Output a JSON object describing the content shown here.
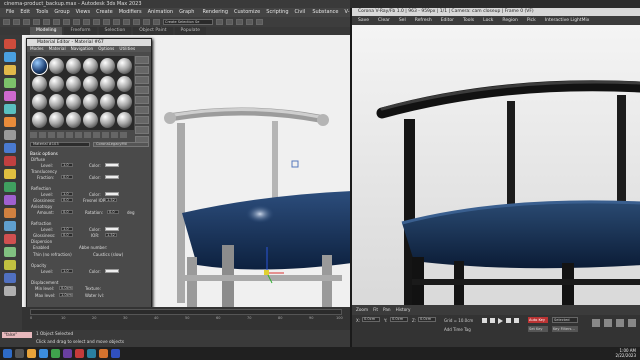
{
  "app": {
    "window_title": "cinema-product_backup.max - Autodesk 3ds Max 2023",
    "menu": [
      "File",
      "Edit",
      "Tools",
      "Group",
      "Views",
      "Create",
      "Modifiers",
      "Animation",
      "Graph Editors",
      "Rendering",
      "Customize",
      "Scripting",
      "Civil View",
      "Substance",
      "V-Ray",
      "Arnold",
      "Help"
    ],
    "toolbar_dropdown": "Create Selection Se",
    "ribbon_tabs": [
      "Modeling",
      "Freeform",
      "Selection",
      "Object Paint",
      "Populate"
    ],
    "ribbon_sub": "Polygon Modeling"
  },
  "material_editor": {
    "title": "Material Editor - Material #67",
    "menu": [
      "Modes",
      "Material",
      "Navigation",
      "Options",
      "Utilities"
    ],
    "material_name": "Material #103",
    "material_type": "CoronaLegacyMtl",
    "sections": {
      "basic": "Basic options",
      "diffuse": "Diffuse",
      "level": "Level:",
      "level_val": "1.0",
      "color": "Color:",
      "translucency": "Translucency",
      "fraction": "Fraction:",
      "fraction_val": "0.0",
      "reflection": "Reflection",
      "glossiness": "Glossiness:",
      "gloss_val": "0.0",
      "fresnel": "Fresnel IOR:",
      "fresnel_val": "1.52",
      "anisotropy": "Anisotropy",
      "amount": "Amount:",
      "amount_val": "0.0",
      "rotation": "Rotation:",
      "rot_val": "0.0",
      "deg": "deg",
      "refraction": "Refraction",
      "ior": "IOR:",
      "ior_val": "1.52",
      "dispersion": "Dispersion",
      "enabled": "Enabled",
      "abbe": "Abbe number:",
      "thin": "Thin (no refraction)",
      "caustics": "Caustics (slow)",
      "opacity": "Opacity",
      "displacement": "Displacement",
      "min_level": "Min level:",
      "min_val": "0.0cm",
      "texture": "Texture:",
      "max_level": "Max level:",
      "max_val": "1.0cm",
      "water_level": "Water lvl:"
    }
  },
  "status": {
    "maxscript": "\"false\"",
    "line1": "1 Object Selected",
    "line2": "Click and drag to select and move objects"
  },
  "timeline": {
    "ticks": [
      "0",
      "10",
      "20",
      "30",
      "40",
      "50",
      "60",
      "70",
      "80",
      "90",
      "100"
    ]
  },
  "render_window": {
    "title": "Corona V-Ray/Fb 1.0 | 963 - 959px | 1/1 | Camera: cam closeup | Frame 0 (VF)",
    "toolbar": [
      "Save",
      "Clear",
      "Sel",
      "Refresh",
      "Editor",
      "Tools",
      "Lock",
      "Region",
      "Pick",
      "Interactive LightMix"
    ],
    "bottom": [
      "Zoom",
      "Fit",
      "Pan",
      "History"
    ],
    "controls": {
      "x": "X:",
      "x_val": "0.0cm",
      "y": "Y:",
      "y_val": "0.0cm",
      "z": "Z:",
      "z_val": "0.0cm",
      "grid": "Grid = 10.0cm",
      "add_time_tag": "Add Time Tag",
      "auto_key": "Auto Key",
      "selected": "Selected",
      "set_key": "Set Key",
      "key_filters": "Key Filters..."
    }
  },
  "clock": {
    "time": "1:00 AM",
    "date": "2/22/2023"
  },
  "colors": {
    "accent": "#2e6bc7",
    "maxscript_bg": "#e8b9bd"
  }
}
